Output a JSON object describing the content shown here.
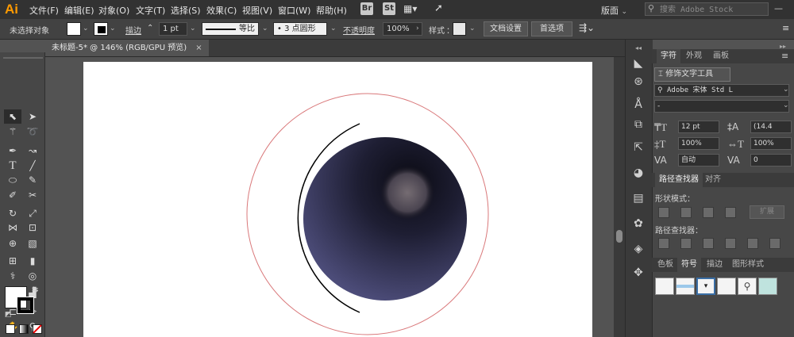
{
  "app": {
    "logo": "Ai",
    "workspace": "版面",
    "search_placeholder": "搜索 Adobe Stock"
  },
  "menu": [
    "文件(F)",
    "编辑(E)",
    "对象(O)",
    "文字(T)",
    "选择(S)",
    "效果(C)",
    "视图(V)",
    "窗口(W)",
    "帮助(H)"
  ],
  "menubar_buttons": {
    "bridge": "Br",
    "stock": "St"
  },
  "control": {
    "selection": "未选择对象",
    "stroke_label": "描边",
    "stroke_value": "1 pt",
    "line_profile": "等比",
    "brush": "3 点圆形",
    "opacity_label": "不透明度",
    "opacity_value": "100%",
    "style_label": "样式",
    "doc_setup": "文档设置",
    "prefs": "首选项"
  },
  "document": {
    "tab_title": "未标题-5* @ 146% (RGB/GPU 预览)",
    "close": "×"
  },
  "panel": {
    "top_tabs": [
      "字符",
      "外观",
      "画板"
    ],
    "touch_type": "修饰文字工具",
    "font_family": "Adobe 宋体 Std L",
    "font_style": "-",
    "font_size": "12 pt",
    "leading": "(14.4",
    "h_scale": "100%",
    "v_scale": "100%",
    "kerning": "自动",
    "tracking": "0",
    "pathfinder_tabs": [
      "路径查找器",
      "对齐"
    ],
    "shape_modes": "形状模式：",
    "expand": "扩展",
    "pathfinders": "路径查找器：",
    "bottom_tabs": [
      "色板",
      "符号",
      "描边",
      "图形样式"
    ]
  },
  "colors": {
    "sphere_light": "#5c5c91",
    "sphere_dark": "#0a0a12",
    "highlight": "#756c72",
    "guide_circle": "#d9787a",
    "arc": "#000000",
    "accent": "#ff9a00"
  },
  "icons": [
    "selection-icon",
    "direct-selection-icon",
    "magic-wand-icon",
    "lasso-icon",
    "pen-icon",
    "curvature-icon",
    "type-icon",
    "line-icon",
    "ellipse-icon",
    "paintbrush-icon",
    "shaper-icon",
    "scissors-icon",
    "rotate-icon",
    "scale-icon",
    "width-icon",
    "free-transform-icon",
    "shape-builder-icon",
    "perspective-icon",
    "mesh-icon",
    "gradient-icon",
    "eyedropper-icon",
    "blend-icon",
    "symbol-sprayer-icon",
    "graph-icon",
    "artboard-icon",
    "slice-icon",
    "hand-icon",
    "zoom-icon"
  ]
}
